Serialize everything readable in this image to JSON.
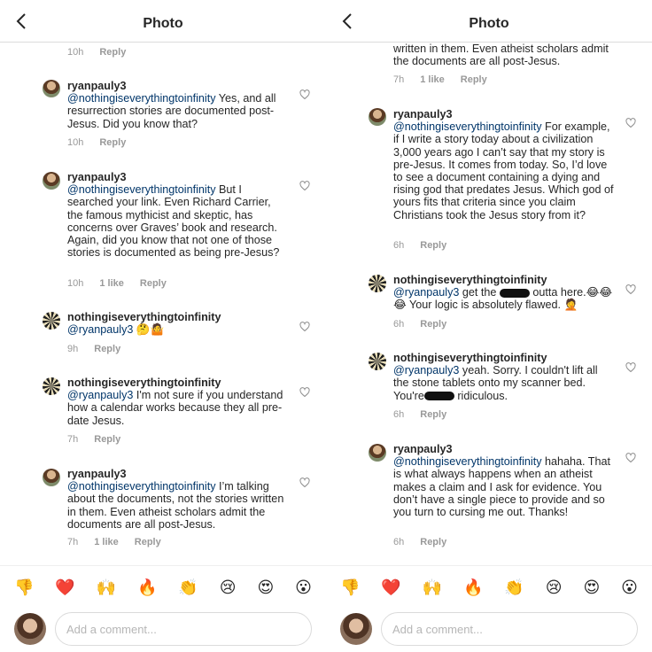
{
  "header": {
    "title": "Photo"
  },
  "left": {
    "comments": [
      {
        "username": "",
        "mention": "",
        "text": "",
        "time": "10h",
        "likes": "",
        "reply": "Reply"
      },
      {
        "username": "ryanpauly3",
        "mention": "@nothingiseverythingtoinfinity",
        "text": " Yes, and all resurrection stories are documented post-Jesus. Did you know that?",
        "time": "10h",
        "likes": "",
        "reply": "Reply"
      },
      {
        "username": "ryanpauly3",
        "mention": "@nothingiseverythingtoinfinity",
        "text": " But I searched your link. Even Richard Carrier, the famous mythicist and skeptic, has concerns over Graves’ book and research. Again, did you know that not one of those stories is documented as being pre-Jesus?",
        "time": "10h",
        "likes": "1 like",
        "reply": "Reply"
      },
      {
        "username": "nothingiseverythingtoinfinity",
        "mention": "@ryanpauly3",
        "text": " 🤔🤷",
        "time": "9h",
        "likes": "",
        "reply": "Reply"
      },
      {
        "username": "nothingiseverythingtoinfinity",
        "mention": "@ryanpauly3",
        "text": " I'm not sure if you understand how a calendar works because they all pre-date Jesus.",
        "time": "7h",
        "likes": "",
        "reply": "Reply"
      },
      {
        "username": "ryanpauly3",
        "mention": "@nothingiseverythingtoinfinity",
        "text": " I’m talking about the documents, not the stories written in them. Even atheist scholars admit the documents are all post-Jesus.",
        "time": "7h",
        "likes": "1 like",
        "reply": "Reply"
      }
    ]
  },
  "right": {
    "comments": [
      {
        "username": "",
        "mention": "",
        "text": "written in them. Even atheist scholars admit the documents are all post-Jesus.",
        "time": "7h",
        "likes": "1 like",
        "reply": "Reply"
      },
      {
        "username": "ryanpauly3",
        "mention": "@nothingiseverythingtoinfinity",
        "text": " For example, if I write a story today about a civilization 3,000 years ago I can’t say that my story is pre-Jesus. It comes from today. So, I’d love to see a document containing a dying and rising god that predates Jesus. Which god of yours fits that criteria since you claim Christians took the Jesus story from it?",
        "time": "6h",
        "likes": "",
        "reply": "Reply"
      },
      {
        "username": "nothingiseverythingtoinfinity",
        "mention": "@ryanpauly3",
        "text_a": "  get the ",
        "text_b": " outta here.😂😂😂 Your logic is absolutely flawed. 🤦",
        "time": "6h",
        "likes": "",
        "reply": "Reply"
      },
      {
        "username": "nothingiseverythingtoinfinity",
        "mention": "@ryanpauly3",
        "text_a": "  yeah. Sorry. I couldn't lift all the stone tablets onto my scanner bed. You're",
        "text_b": " ridiculous.",
        "time": "6h",
        "likes": "",
        "reply": "Reply"
      },
      {
        "username": "ryanpauly3",
        "mention": "@nothingiseverythingtoinfinity",
        "text": " hahaha. That is what always happens when an atheist makes a claim and I ask for evidence. You don’t have a single piece to provide and so you turn to cursing me out. Thanks!",
        "time": "6h",
        "likes": "",
        "reply": "Reply"
      }
    ]
  },
  "emojis": [
    "👎",
    "❤️",
    "🙌",
    "🔥",
    "👏",
    "😢",
    "😍",
    "😮"
  ],
  "input": {
    "placeholder": "Add a comment..."
  }
}
